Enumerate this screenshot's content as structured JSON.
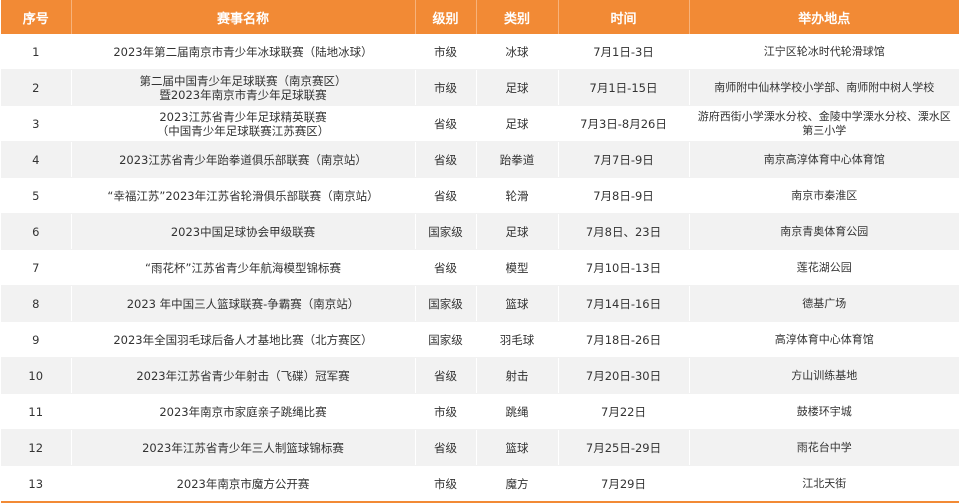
{
  "chart_data": {
    "type": "table",
    "accent_color": "#f28a35",
    "columns": [
      "序号",
      "赛事名称",
      "级别",
      "类别",
      "时间",
      "举办地点"
    ],
    "rows": [
      [
        "1",
        "2023年第二届南京市青少年冰球联赛（陆地冰球）",
        "市级",
        "冰球",
        "7月1日-3日",
        "江宁区轮冰时代轮滑球馆"
      ],
      [
        "2",
        "第二届中国青少年足球联赛（南京赛区）\n暨2023年南京市青少年足球联赛",
        "市级",
        "足球",
        "7月1日-15日",
        "南师附中仙林学校小学部、南师附中树人学校"
      ],
      [
        "3",
        "2023江苏省青少年足球精英联赛\n（中国青少年足球联赛江苏赛区）",
        "省级",
        "足球",
        "7月3日-8月26日",
        "游府西街小学溧水分校、金陵中学溧水分校、溧水区第三小学"
      ],
      [
        "4",
        "2023江苏省青少年跆拳道俱乐部联赛（南京站）",
        "省级",
        "跆拳道",
        "7月7日-9日",
        "南京高淳体育中心体育馆"
      ],
      [
        "5",
        "“幸福江苏”2023年江苏省轮滑俱乐部联赛（南京站）",
        "省级",
        "轮滑",
        "7月8日-9日",
        "南京市秦淮区"
      ],
      [
        "6",
        "2023中国足球协会甲级联赛",
        "国家级",
        "足球",
        "7月8日、23日",
        "南京青奥体育公园"
      ],
      [
        "7",
        "“雨花杯”江苏省青少年航海模型锦标赛",
        "省级",
        "模型",
        "7月10日-13日",
        "莲花湖公园"
      ],
      [
        "8",
        "2023 年中国三人篮球联赛-争霸赛（南京站）",
        "国家级",
        "篮球",
        "7月14日-16日",
        "德基广场"
      ],
      [
        "9",
        "2023年全国羽毛球后备人才基地比赛（北方赛区）",
        "国家级",
        "羽毛球",
        "7月18日-26日",
        "高淳体育中心体育馆"
      ],
      [
        "10",
        "2023年江苏省青少年射击（飞碟）冠军赛",
        "省级",
        "射击",
        "7月20日-30日",
        "方山训练基地"
      ],
      [
        "11",
        "2023年南京市家庭亲子跳绳比赛",
        "市级",
        "跳绳",
        "7月22日",
        "鼓楼环宇城"
      ],
      [
        "12",
        "2023年江苏省青少年三人制篮球锦标赛",
        "省级",
        "篮球",
        "7月25日-29日",
        "雨花台中学"
      ],
      [
        "13",
        "2023年南京市魔方公开赛",
        "市级",
        "魔方",
        "7月29日",
        "江北天街"
      ]
    ]
  }
}
